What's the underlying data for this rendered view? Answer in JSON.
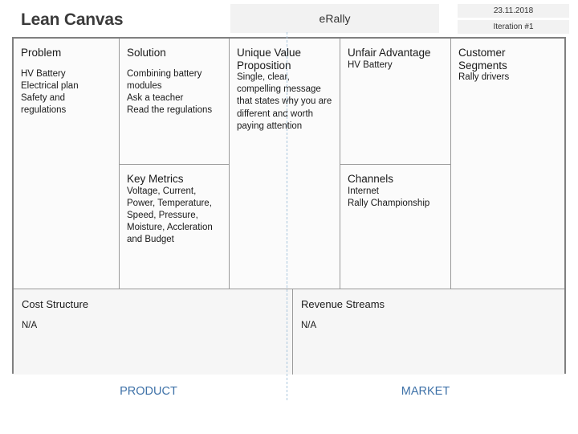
{
  "header": {
    "title": "Lean Canvas",
    "project": "eRally",
    "date": "23.11.2018",
    "iteration": "Iteration #1"
  },
  "canvas": {
    "problem": {
      "title": "Problem",
      "body": "HV Battery\nElectrical plan\nSafety and regulations"
    },
    "solution": {
      "title": "Solution",
      "body": "Combining battery\nmodules\nAsk a teacher\nRead the regulations"
    },
    "key_metrics": {
      "title": "Key Metrics",
      "body": "Voltage, Current,\nPower, Temperature,\nSpeed, Pressure,\nMoisture, Accleration\nand Budget"
    },
    "unique_value_proposition": {
      "title": "Unique Value\nProposition",
      "body": "Single, clear,\ncompelling message\nthat states why you are\ndifferent and worth\npaying attention"
    },
    "unfair_advantage": {
      "title": "Unfair Advantage",
      "body": "HV Battery"
    },
    "channels": {
      "title": "Channels",
      "body": "Internet\nRally Championship"
    },
    "customer_segments": {
      "title": "Customer\nSegments",
      "body": "Rally drivers"
    },
    "cost_structure": {
      "title": "Cost Structure",
      "body": "N/A"
    },
    "revenue_streams": {
      "title": "Revenue Streams",
      "body": "N/A"
    }
  },
  "footer": {
    "product_label": "PRODUCT",
    "market_label": "MARKET"
  },
  "colors": {
    "accent_blue": "#3f72a8",
    "split_line": "#a9c6dd",
    "frame_border": "#808080",
    "chip_background": "#f2f2f2"
  }
}
